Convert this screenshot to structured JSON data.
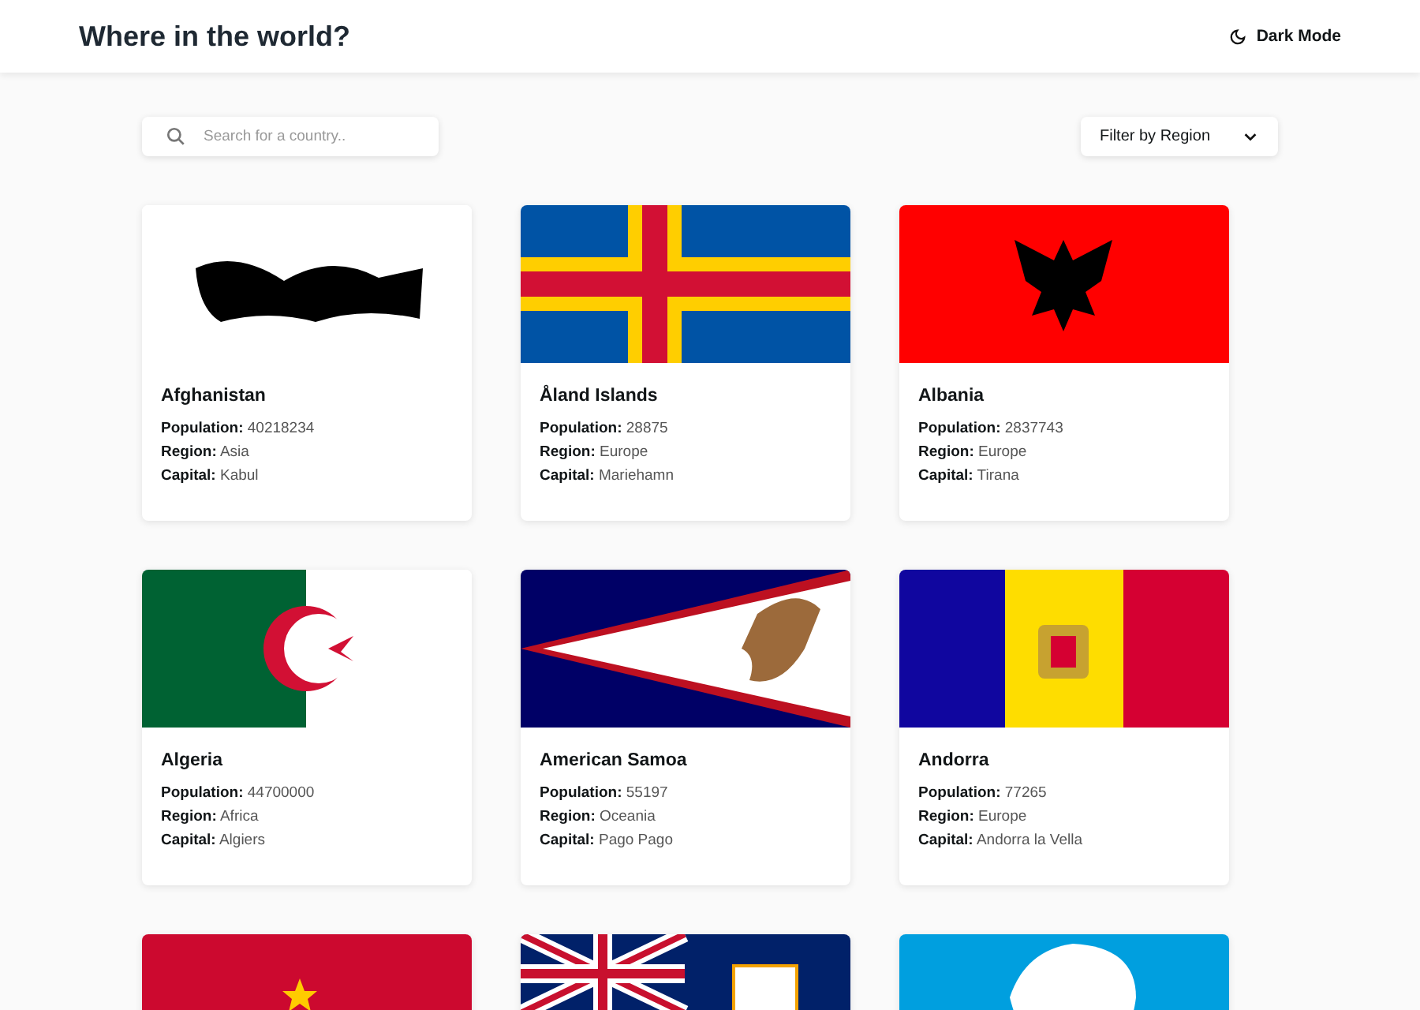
{
  "header": {
    "title": "Where in the world?",
    "theme_toggle": "Dark Mode"
  },
  "search": {
    "placeholder": "Search for a country.."
  },
  "filter": {
    "label": "Filter by Region"
  },
  "countries": [
    {
      "name": "Afghanistan",
      "kind": "afghanistan",
      "details": [
        "**Population:** 40218234",
        "**Region:** Asia",
        "**Capital:** Kabul"
      ]
    },
    {
      "name": "Åland Islands",
      "kind": "aland",
      "details": [
        "**Population:** 28875",
        "**Region:** Europe",
        "**Capital:** Mariehamn"
      ]
    },
    {
      "name": "Albania",
      "kind": "albania",
      "details": [
        "**Population:** 2837743",
        "**Region:** Europe",
        "**Capital:** Tirana"
      ]
    },
    {
      "name": "Algeria",
      "kind": "algeria",
      "details": [
        "**Population:** 44700000",
        "**Region:** Africa",
        "**Capital:** Algiers"
      ]
    },
    {
      "name": "American Samoa",
      "kind": "samoa",
      "details": [
        "**Population:** 55197",
        "**Region:** Oceania",
        "**Capital:** Pago Pago"
      ]
    },
    {
      "name": "Andorra",
      "kind": "andorra",
      "details": [
        "**Population:** 77265",
        "**Region:** Europe",
        "**Capital:** Andorra la Vella"
      ]
    },
    {
      "kind": "angola"
    },
    {
      "kind": "anguilla"
    },
    {
      "kind": "antarctica"
    }
  ]
}
